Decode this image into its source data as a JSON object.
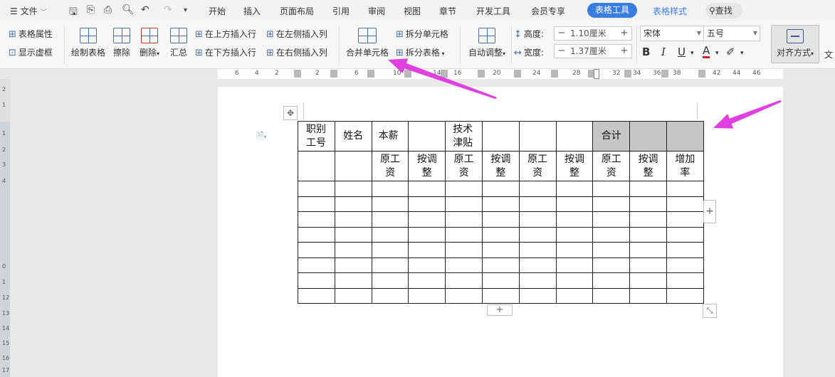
{
  "menubar": {
    "app_menu_label": "文件",
    "tabs": [
      "开始",
      "插入",
      "页面布局",
      "引用",
      "审阅",
      "视图",
      "章节",
      "开发工具",
      "会员专享"
    ],
    "active_tab": "表格工具",
    "style_tab": "表格样式",
    "search_label": "查找"
  },
  "ribbon": {
    "table_props": "表格属性",
    "show_grid": "显示虚框",
    "draw_table": "绘制表格",
    "erase": "擦除",
    "delete": "删除",
    "summary": "汇总",
    "insert_above": "在上方插入行",
    "insert_below": "在下方插入行",
    "insert_left": "在左侧插入列",
    "insert_right": "在右侧插入列",
    "merge_cells": "合并单元格",
    "split_cells": "拆分单元格",
    "split_table": "拆分表格",
    "auto_fit": "自动调整",
    "height_label": "高度:",
    "height_value": "1.10厘米",
    "width_label": "宽度:",
    "width_value": "1.37厘米",
    "font_name": "宋体",
    "font_size": "五号",
    "align_label": "对齐方式",
    "text_cut": "文"
  },
  "ruler": {
    "marks": [
      "6",
      "4",
      "2",
      "2",
      "6",
      "10",
      "14",
      "16",
      "20",
      "24",
      "28",
      "32",
      "34",
      "36",
      "38",
      "42",
      "44",
      "46"
    ]
  },
  "vruler": {
    "marks": [
      "2",
      "1",
      "1",
      "2",
      "3",
      "4",
      "0",
      "1",
      "12",
      "13",
      "14",
      "15",
      "16",
      "17"
    ]
  },
  "table": {
    "header_row1": [
      "职别\n工号",
      "姓名",
      "本薪",
      "",
      "技术\n津贴",
      "",
      "",
      "",
      "合计",
      "",
      ""
    ],
    "header_row2": [
      "",
      "",
      "原工\n资",
      "按调\n整",
      "原工\n资",
      "按调\n整",
      "原工\n资",
      "按调\n整",
      "原工\n资",
      "按调\n整",
      "增加\n率"
    ],
    "empty_rows": 8,
    "highlight_color": "#c6c6c6"
  },
  "annotations": {
    "arrow_color": "#e040e0"
  }
}
